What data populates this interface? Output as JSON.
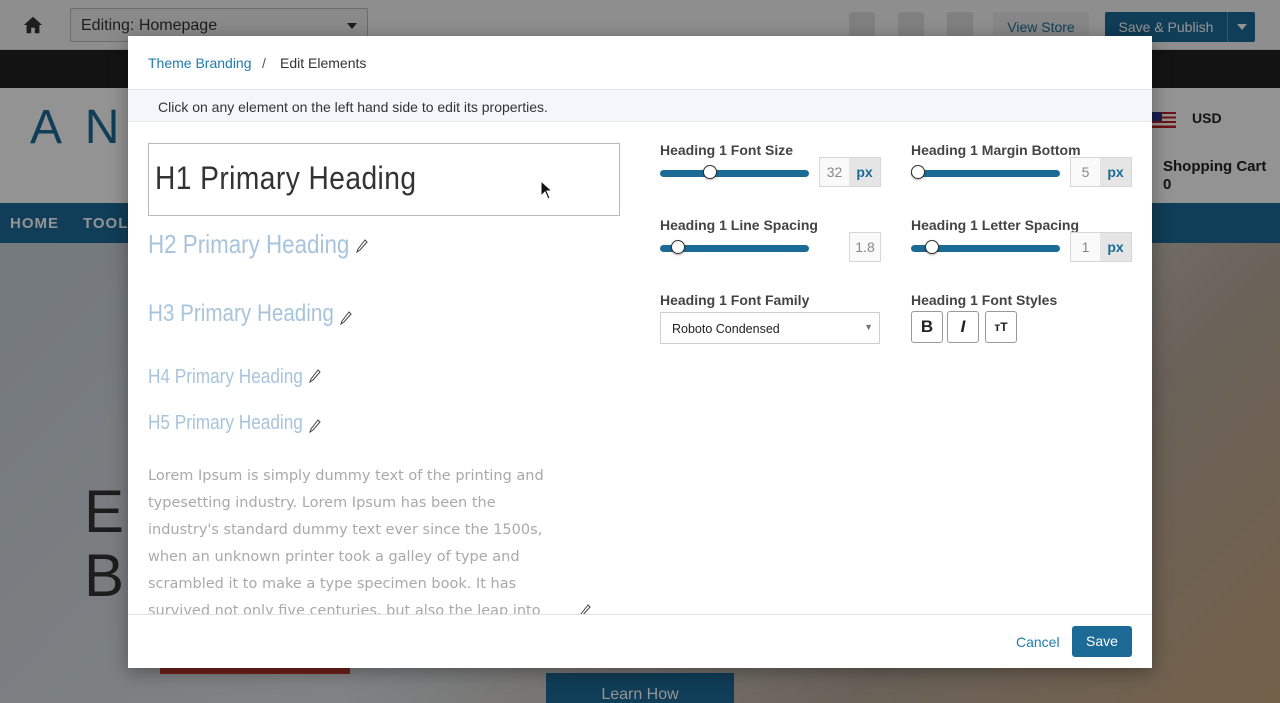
{
  "background": {
    "page_select": "Editing: Homepage",
    "view_store": "View Store",
    "save_publish": "Save & Publish",
    "currency": "USD",
    "cart_label": "Shopping Cart",
    "cart_count": "0",
    "nav_items": [
      "HOME",
      "TOOLS"
    ],
    "learn_button": "Learn How"
  },
  "modal": {
    "breadcrumb": {
      "parent": "Theme Branding",
      "separator": "/",
      "current": "Edit Elements"
    },
    "info": "Click on any element on the left hand side to edit its properties.",
    "samples": {
      "h1": "H1 Primary Heading",
      "h2": "H2 Primary Heading",
      "h3": "H3 Primary Heading",
      "h4": "H4 Primary Heading",
      "h5": "H5 Primary Heading",
      "paragraph": "Lorem Ipsum is simply dummy text of the printing and typesetting industry. Lorem Ipsum has been the industry's standard dummy text ever since the 1500s, when an unknown printer took a galley of type and scrambled it to make a type specimen book. It has survived not only five centuries, but also the leap into"
    },
    "controls": {
      "font_size": {
        "label": "Heading 1 Font Size",
        "value": "32",
        "unit": "px",
        "slider_fraction": 0.32
      },
      "margin_bottom": {
        "label": "Heading 1 Margin Bottom",
        "value": "5",
        "unit": "px",
        "slider_fraction": 0.0
      },
      "line_spacing": {
        "label": "Heading 1 Line Spacing",
        "value": "1.8",
        "slider_fraction": 0.08
      },
      "letter_spacing": {
        "label": "Heading 1 Letter Spacing",
        "value": "1",
        "unit": "px",
        "slider_fraction": 0.1
      },
      "font_family": {
        "label": "Heading 1 Font Family",
        "value": "Roboto Condensed"
      },
      "font_styles": {
        "label": "Heading 1 Font Styles",
        "bold": "B",
        "italic": "I",
        "transform": "тТ"
      }
    },
    "footer": {
      "cancel": "Cancel",
      "save": "Save"
    }
  },
  "colors": {
    "accent": "#1c6a96",
    "link": "#1e7cb0",
    "sample_heading": "#a8c4dd"
  }
}
